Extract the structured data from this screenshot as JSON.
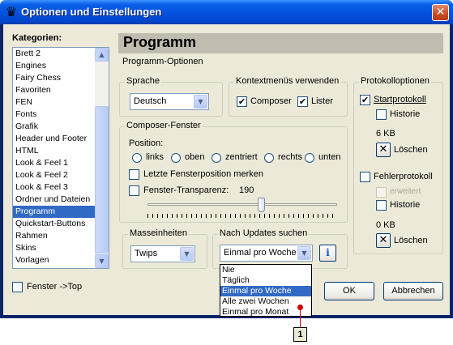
{
  "window": {
    "title": "Optionen und Einstellungen",
    "close_glyph": "✕",
    "app_icon": "chess-queen-icon"
  },
  "categories": {
    "label": "Kategorien:",
    "items": [
      "Brett 2",
      "Engines",
      "Fairy Chess",
      "Favoriten",
      "FEN",
      "Fonts",
      "Grafik",
      "Header und Footer",
      "HTML",
      "Look & Feel 1",
      "Look & Feel 2",
      "Look & Feel 3",
      "Ordner und Dateien",
      "Programm",
      "Quickstart-Buttons",
      "Rahmen",
      "Skins",
      "Vorlagen"
    ],
    "selected": "Programm"
  },
  "panel": {
    "title": "Programm",
    "subtitle": "Programm-Optionen"
  },
  "sprache": {
    "title": "Sprache",
    "value": "Deutsch"
  },
  "kontext": {
    "title": "Kontextmenüs verwenden",
    "composer_label": "Composer",
    "composer_checked": true,
    "lister_label": "Lister",
    "lister_checked": true
  },
  "composer_fenster": {
    "title": "Composer-Fenster",
    "position_label": "Position:",
    "positions": [
      "links",
      "oben",
      "zentriert",
      "rechts",
      "unten"
    ],
    "letzte_label": "Letzte Fensterposition merken",
    "letzte_checked": false,
    "transparenz_label": "Fenster-Transparenz:",
    "transparenz_checked": false,
    "transparenz_value": "190",
    "slider_fraction": 0.6
  },
  "protokoll": {
    "title": "Protokolloptionen",
    "start_label": "Startprotokoll",
    "start_checked": true,
    "historie1_label": "Historie",
    "historie1_checked": false,
    "size1": "6 KB",
    "loeschen1": "Löschen",
    "fehler_label": "Fehlerprotokoll",
    "fehler_checked": false,
    "erweitert_label": "erweitert",
    "historie2_label": "Historie",
    "historie2_checked": false,
    "size2": "0 KB",
    "loeschen2": "Löschen",
    "x_glyph": "✕"
  },
  "masseinheiten": {
    "title": "Masseinheiten",
    "value": "Twips"
  },
  "updates": {
    "title": "Nach Updates suchen",
    "value": "Einmal pro Woche",
    "info_glyph": "i",
    "options": [
      "Nie",
      "Täglich",
      "Einmal pro Woche",
      "Alle zwei Wochen",
      "Einmal pro Monat"
    ],
    "selected": "Einmal pro Woche"
  },
  "fenster_top": {
    "label": "Fenster ->Top",
    "checked": false
  },
  "buttons": {
    "ok": "OK",
    "abbrechen": "Abbrechen"
  },
  "callout": {
    "number": "1"
  },
  "glyphs": {
    "check": "✔",
    "up": "▲",
    "down": "▼"
  }
}
